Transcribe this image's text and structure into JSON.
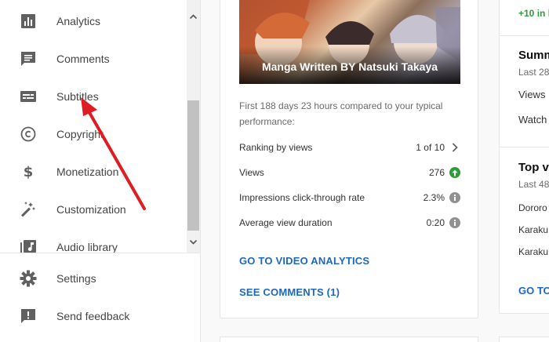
{
  "sidebar": {
    "items": [
      {
        "label": "Analytics",
        "icon": "analytics-icon"
      },
      {
        "label": "Comments",
        "icon": "comments-icon"
      },
      {
        "label": "Subtitles",
        "icon": "subtitles-icon"
      },
      {
        "label": "Copyright",
        "icon": "copyright-icon"
      },
      {
        "label": "Monetization",
        "icon": "dollar-icon"
      },
      {
        "label": "Customization",
        "icon": "magic-wand-icon"
      },
      {
        "label": "Audio library",
        "icon": "audio-library-icon"
      }
    ],
    "footer": [
      {
        "label": "Settings",
        "icon": "gear-icon"
      },
      {
        "label": "Send feedback",
        "icon": "feedback-icon"
      }
    ]
  },
  "video_card": {
    "thumbnail_title": "Manga Written BY Natsuki Takaya",
    "compare_text": "First 188 days 23 hours compared to your typical performance:",
    "stats": [
      {
        "label": "Ranking by views",
        "value": "1 of 10",
        "badge": "chevron-right-icon"
      },
      {
        "label": "Views",
        "value": "276",
        "badge": "up-arrow-icon"
      },
      {
        "label": "Impressions click-through rate",
        "value": "2.3%",
        "badge": "info-icon"
      },
      {
        "label": "Average view duration",
        "value": "0:20",
        "badge": "info-icon"
      }
    ],
    "analytics_link": "GO TO VIDEO ANALYTICS",
    "comments_link": "SEE COMMENTS (1)"
  },
  "right_card": {
    "delta": "+10 in l",
    "summary_title": "Summ",
    "summary_sub": "Last 28",
    "metric_1": "Views",
    "metric_2": "Watch",
    "top_title": "Top vi",
    "top_sub": "Last 48",
    "videos": [
      "Dororo",
      "Karaku",
      "Karaku"
    ],
    "link": "GO TO"
  },
  "colors": {
    "accent_link": "#1e67c0",
    "positive": "#2e9a3a",
    "annotation": "#e11b22"
  }
}
